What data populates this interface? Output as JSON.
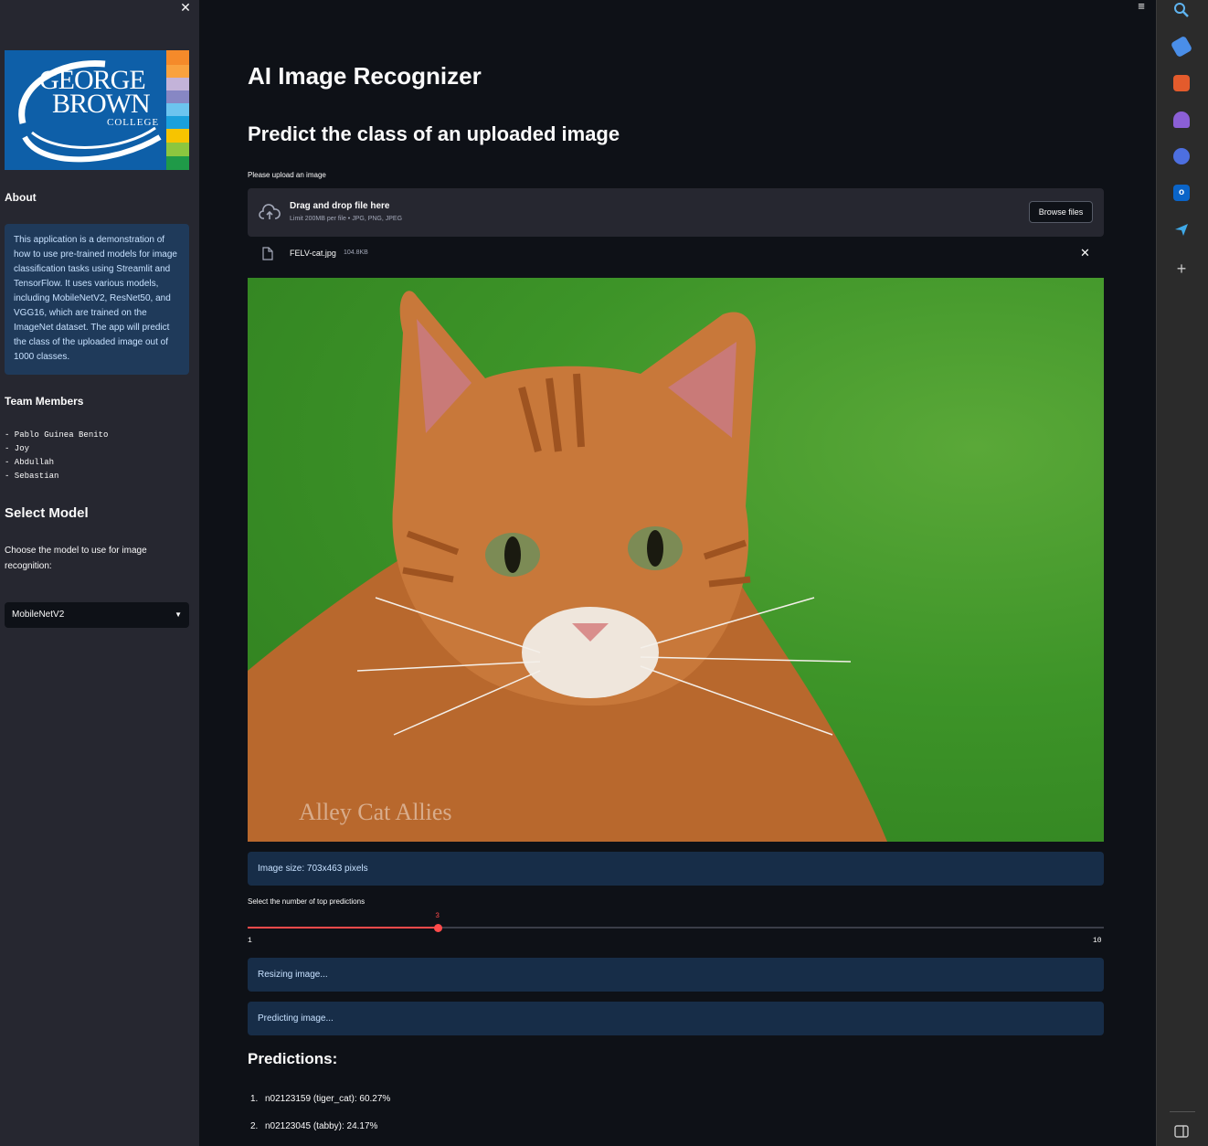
{
  "sidebar": {
    "close_label": "✕",
    "logo": {
      "line1": "GEORGE",
      "line2": "BROWN",
      "line3": "COLLEGE"
    },
    "about_heading": "About",
    "about_text": "This application is a demonstration of how to use pre-trained models for image classification tasks using Streamlit and TensorFlow. It uses various models, including MobileNetV2, ResNet50, and VGG16, which are trained on the ImageNet dataset. The app will predict the class of the uploaded image out of 1000 classes.",
    "team_heading": "Team Members",
    "team_members": [
      "- Pablo Guinea Benito",
      "- Joy",
      "- Abdullah",
      "- Sebastian"
    ],
    "select_heading": "Select Model",
    "select_desc": "Choose the model to use for image recognition:",
    "selected_model": "MobileNetV2"
  },
  "main": {
    "title": "AI Image Recognizer",
    "subtitle": "Predict the class of an uploaded image",
    "upload_label": "Please upload an image",
    "drop_title": "Drag and drop file here",
    "drop_limit": "Limit 200MB per file • JPG, PNG, JPEG",
    "browse_label": "Browse files",
    "file_name": "FELV-cat.jpg",
    "file_size": "104.8KB",
    "watermark": "Alley Cat Allies",
    "image_size_text": "Image size: 703x463 pixels",
    "slider_label": "Select the number of top predictions",
    "slider": {
      "min": 1,
      "max": 10,
      "value": 3
    },
    "status_resizing": "Resizing image...",
    "status_predicting": "Predicting image...",
    "predictions_heading": "Predictions:",
    "predictions": [
      {
        "num": "1.",
        "text": "n02123159 (tiger_cat): 60.27%"
      },
      {
        "num": "2.",
        "text": "n02123045 (tabby): 24.17%"
      }
    ]
  },
  "colors": {
    "accent": "#ff4b4b",
    "background": "#0e1117",
    "sidebar": "#262730",
    "info_box": "#172d48"
  },
  "rail_icons": [
    "search-icon",
    "tag-icon",
    "briefcase-icon",
    "chess-icon",
    "copilot-icon",
    "outlook-icon",
    "send-icon",
    "add-icon",
    "sidebar-toggle-icon"
  ]
}
